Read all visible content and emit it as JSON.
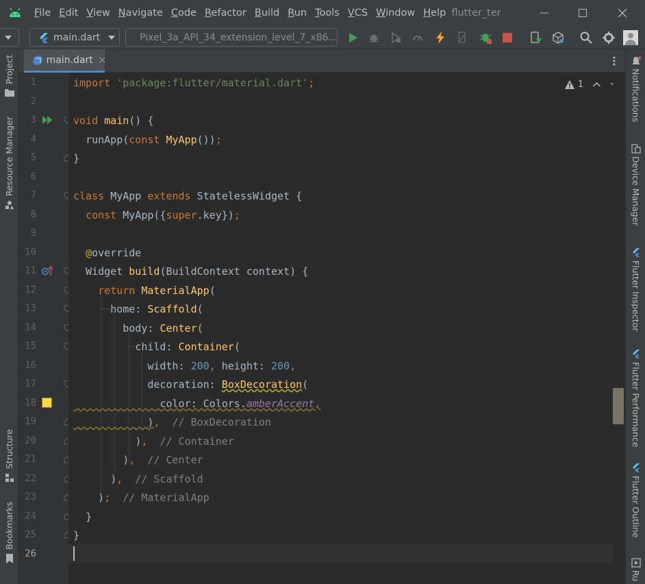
{
  "menubar": {
    "items": [
      {
        "label": "File",
        "mnemonic": "F",
        "rest": "ile"
      },
      {
        "label": "Edit",
        "mnemonic": "E",
        "rest": "dit"
      },
      {
        "label": "View",
        "mnemonic": "V",
        "rest": "iew"
      },
      {
        "label": "Navigate",
        "mnemonic": "N",
        "rest": "avigate"
      },
      {
        "label": "Code",
        "mnemonic": "C",
        "rest": "ode"
      },
      {
        "label": "Refactor",
        "mnemonic": "R",
        "rest": "efactor"
      },
      {
        "label": "Build",
        "mnemonic": "B",
        "rest": "uild"
      },
      {
        "label": "Run",
        "mnemonic": "R",
        "rest": "un"
      },
      {
        "label": "Tools",
        "mnemonic": "T",
        "rest": "ools"
      },
      {
        "label": "VCS",
        "mnemonic": "V",
        "rest": "CS"
      },
      {
        "label": "Window",
        "mnemonic": "W",
        "rest": "indow"
      },
      {
        "label": "Help",
        "mnemonic": "H",
        "rest": "elp"
      }
    ],
    "project_name": "flutter_ten"
  },
  "toolbar": {
    "run_config": "main.dart",
    "device": "Pixel_3a_API_34_extension_level_7_x86..."
  },
  "left_tools": {
    "project": "Project",
    "resource_manager": "Resource Manager",
    "structure": "Structure",
    "bookmarks": "Bookmarks"
  },
  "right_tools": {
    "notifications": "Notifications",
    "device_manager": "Device Manager",
    "flutter_inspector": "Flutter Inspector",
    "flutter_performance": "Flutter Performance",
    "flutter_outline": "Flutter Outline",
    "run": "Ru"
  },
  "editor": {
    "tab_label": "main.dart",
    "warning_count": "1",
    "line_numbers": [
      "1",
      "2",
      "3",
      "4",
      "5",
      "6",
      "7",
      "8",
      "9",
      "10",
      "11",
      "12",
      "13",
      "14",
      "15",
      "16",
      "17",
      "18",
      "19",
      "20",
      "21",
      "22",
      "23",
      "24",
      "25",
      "26"
    ],
    "lines": {
      "l1_kw": "import",
      "l1_str": "'package:flutter/material.dart'",
      "l1_semi": ";",
      "l3_kw": "void",
      "l3_fn": "main",
      "l3_rest": "() {",
      "l4_a": "runApp(",
      "l4_kw": "const",
      "l4_fn": "MyApp",
      "l4_b": "())",
      "l4_semi": ";",
      "l5": "}",
      "l7_kw": "class",
      "l7_a": "MyApp",
      "l7_kw2": "extends",
      "l7_b": "StatelessWidget {",
      "l8_kw": "const",
      "l8_a": "MyApp({",
      "l8_kw2": "super",
      "l8_b": ".key})",
      "l8_semi": ";",
      "l10_at": "@",
      "l10_ann": "override",
      "l11_a": "Widget",
      "l11_fn": "build",
      "l11_b": "(BuildContext context) {",
      "l12_kw": "return",
      "l12_fn": "MaterialApp",
      "l12_b": "(",
      "l13_a": "home:",
      "l13_fn": "Scaffold",
      "l13_b": "(",
      "l14_a": "body:",
      "l14_fn": "Center",
      "l14_b": "(",
      "l15_a": "child:",
      "l15_fn": "Container",
      "l15_b": "(",
      "l16_a": "width:",
      "l16_n1": "200",
      "l16_c": ",",
      "l16_b": "height:",
      "l16_n2": "200",
      "l16_c2": ",",
      "l17_a": "decoration:",
      "l17_fn": "BoxDecoration",
      "l17_b": "(",
      "l18_a": "color: Colors.",
      "l18_static": "amberAccent",
      "l18_c": ",",
      "l19_a": ")",
      "l19_c": ",",
      "l19_cm": "// BoxDecoration",
      "l20_a": ")",
      "l20_c": ",",
      "l20_cm": "// Container",
      "l21_a": ")",
      "l21_c": ",",
      "l21_cm": "// Center",
      "l22_a": ")",
      "l22_c": ",",
      "l22_cm": "// Scaffold",
      "l23_a": ")",
      "l23_c": ";",
      "l23_cm": "// MaterialApp",
      "l24": "}",
      "l25": "}"
    }
  },
  "colors": {
    "swatch_amber_accent": "#ffd740",
    "run_green": "#499c54",
    "stop_red": "#c75450",
    "flutter_blue": "#4a88c7"
  }
}
